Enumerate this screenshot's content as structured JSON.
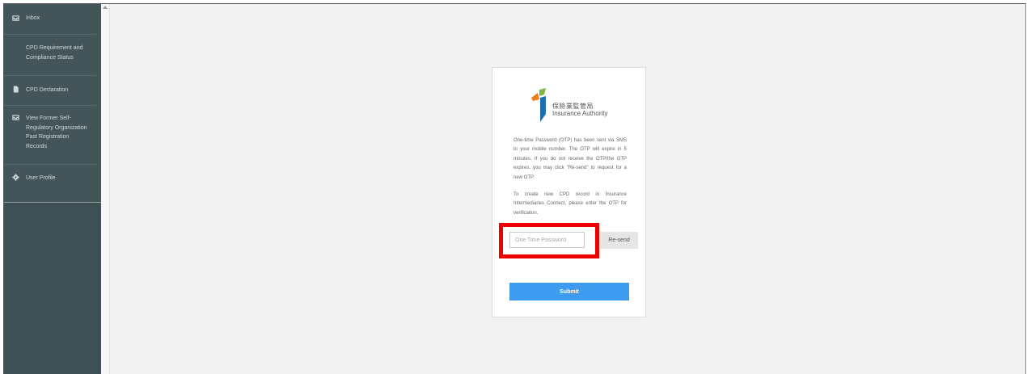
{
  "sidebar": {
    "items": [
      {
        "label": "Inbox",
        "icon": "inbox-icon"
      },
      {
        "label": "CPD Requirement and Compliance Status",
        "icon": ""
      },
      {
        "label": "CPD Declaration",
        "icon": "document-icon"
      },
      {
        "label": "View Former Self-Regulatory Organization Past Registration Records",
        "icon": "inbox-icon"
      },
      {
        "label": "User Profile",
        "icon": "gear-icon"
      }
    ]
  },
  "card": {
    "logo": {
      "chinese_name": "保險業監管局",
      "english_name": "Insurance Authority"
    },
    "message1": "One-time Password (OTP) has been sent via SMS to your mobile number. The OTP will expire in 5 minutes. If you do not receive the OTP/the OTP expires, you may click \"Re-send\" to request for a new OTP.",
    "message2": "To create new CPD record in Insurance Intermediaries Connect, please enter the OTP for verification.",
    "otp_input": {
      "placeholder": "One Time Password",
      "value": ""
    },
    "resend_label": "Re-send",
    "submit_label": "Submit"
  },
  "colors": {
    "sidebar": "#3e5055",
    "submit": "#3d9bf0",
    "highlight": "#ee0000",
    "logo_orange": "#f07d1a",
    "logo_green": "#7ab648",
    "logo_blue": "#1a6fb5"
  }
}
